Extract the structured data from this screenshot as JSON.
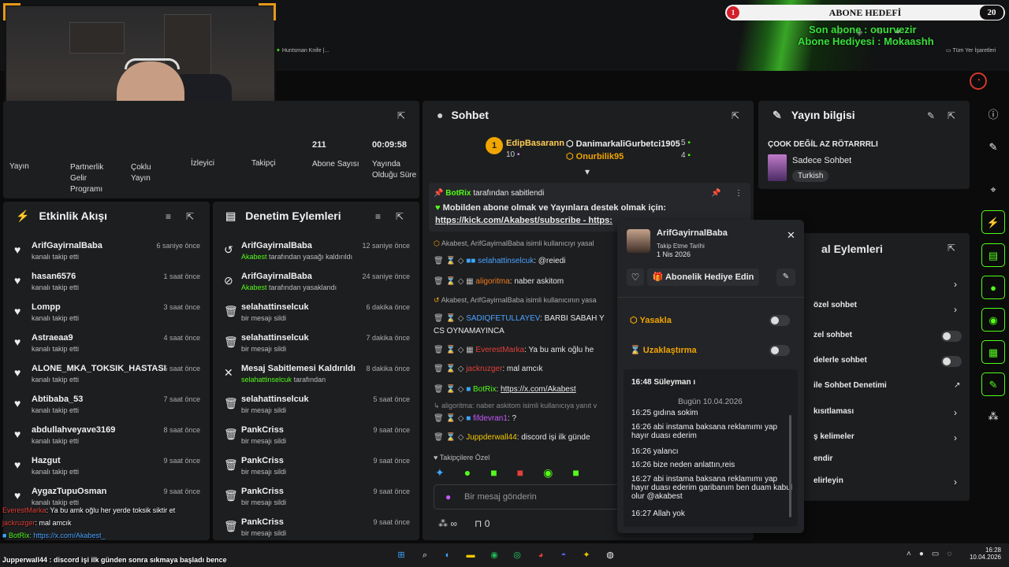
{
  "goal": {
    "left": "1",
    "title": "ABONE HEDEFİ",
    "right": "20"
  },
  "sub": {
    "last": "Son abone : onurvezir",
    "gift": "Abone Hediyesi : Mokaashh"
  },
  "browser": {
    "bookmark": "Huntsman Knife |...",
    "all_bookmarks": "Tüm Yer İşaretleri"
  },
  "stats": {
    "tabs": [
      "Yayın",
      "Partnerlik Gelir Programı",
      "Çoklu Yayın",
      "İzleyici",
      "Takipçi",
      "Abone Sayısı",
      "Yayında Olduğu Süre"
    ],
    "subs_value": "211",
    "time_value": "00:09:58"
  },
  "activity": {
    "title": "Etkinlik Akışı",
    "items": [
      {
        "name": "ArifGayirnalBaba",
        "sub": "kanalı takip etti",
        "time": "6 saniye önce"
      },
      {
        "name": "hasan6576",
        "sub": "kanalı takip etti",
        "time": "1 saat önce"
      },
      {
        "name": "Lompp",
        "sub": "kanalı takip etti",
        "time": "3 saat önce"
      },
      {
        "name": "Astraeaa9",
        "sub": "kanalı takip etti",
        "time": "4 saat önce"
      },
      {
        "name": "ALONE_MKA_TOKSIK_HASTASI",
        "sub": "kanalı takip etti",
        "time": "5 saat önce"
      },
      {
        "name": "Abtibaba_53",
        "sub": "kanalı takip etti",
        "time": "7 saat önce"
      },
      {
        "name": "abdullahveyave3169",
        "sub": "kanalı takip etti",
        "time": "8 saat önce"
      },
      {
        "name": "Hazgut",
        "sub": "kanalı takip etti",
        "time": "9 saat önce"
      },
      {
        "name": "AygazTupuOsman",
        "sub": "kanalı takip etti",
        "time": "9 saat önce"
      }
    ]
  },
  "moderation": {
    "title": "Denetim Eylemleri",
    "items": [
      {
        "name": "ArifGayirnalBaba",
        "sub_green": "Akabest",
        "sub": "tarafından yasağı kaldırıldı",
        "time": "12 saniye önce",
        "icon": "↺"
      },
      {
        "name": "ArifGayirnalBaba",
        "sub_green": "Akabest",
        "sub": "tarafından yasaklandı",
        "time": "24 saniye önce",
        "icon": "⊘"
      },
      {
        "name": "selahattinselcuk",
        "sub_green": "",
        "sub": "bir mesajı sildi",
        "time": "6 dakika önce",
        "icon": "🗑"
      },
      {
        "name": "selahattinselcuk",
        "sub_green": "",
        "sub": "bir mesajı sildi",
        "time": "7 dakika önce",
        "icon": "🗑"
      },
      {
        "name": "Mesaj Sabitlemesi Kaldırıldı",
        "sub_green": "selahattinselcuk",
        "sub": "tarafından",
        "time": "8 dakika önce",
        "icon": "✕"
      },
      {
        "name": "selahattinselcuk",
        "sub_green": "",
        "sub": "bir mesajı sildi",
        "time": "5 saat önce",
        "icon": "🗑"
      },
      {
        "name": "PankCriss",
        "sub_green": "",
        "sub": "bir mesajı sildi",
        "time": "9 saat önce",
        "icon": "🗑"
      },
      {
        "name": "PankCriss",
        "sub_green": "",
        "sub": "bir mesajı sildi",
        "time": "9 saat önce",
        "icon": "🗑"
      },
      {
        "name": "PankCriss",
        "sub_green": "",
        "sub": "bir mesajı sildi",
        "time": "9 saat önce",
        "icon": "🗑"
      },
      {
        "name": "PankCriss",
        "sub_green": "",
        "sub": "bir mesajı sildi",
        "time": "9 saat önce",
        "icon": "🗑"
      }
    ]
  },
  "chat": {
    "title": "Sohbet",
    "top1": "EdipBasarann",
    "top1_count": "10",
    "top2": "DanimarkaliGurbetci1905",
    "top2_count": "5",
    "top3": "Onurbilik95",
    "top3_count": "4",
    "pinned_by": "BotRix",
    "pinned_suffix": "tarafından sabitlendi",
    "pinned_text": "Mobilden abone olmak ve Yayınlara destek olmak için:",
    "pinned_link": "https://kick.com/Akabest/subscribe - https:",
    "reply1": "Akabest, ArifGayirnalBaba isimli kullanıcıyı yasal",
    "m1_user": "selahattinselcuk",
    "m1_text": "@reiedi",
    "m2_user": "aligoritma",
    "m2_text": "naber askitom",
    "reply2": "Akabest, ArifGayirnalBaba isimli kullanıcının yasa",
    "m3_user": "SADIQFETULLAYEV",
    "m3_text": "BARBI SABAH Y",
    "m3_cont": "CS OYNAMAYINCA",
    "m4_user": "EverestMarka",
    "m4_text": "Ya bu amk oğlu he",
    "m5_user": "jackruzger",
    "m5_text": "mal amcık",
    "m6_user": "BotRix",
    "m6_text": "https://x.com/Akabest",
    "reply3": "aligoritma: naber askitom isimli kullanıcıya yanıt v",
    "m7_user": "fifdevran1",
    "m7_text": "?",
    "m8_user": "Juppderwall44",
    "m8_text": "discord işi ilk günde",
    "emote_label": "Takipçilere Özel",
    "input_placeholder": "Bir mesaj gönderin",
    "viewer_count": "0"
  },
  "info": {
    "title": "Yayın bilgisi",
    "stream_title": "ÇOOK DEĞİL AZ RÖTARRRLI",
    "category": "Sadece Sohbet",
    "language": "Turkish"
  },
  "mod_actions": {
    "title": "al Eylemleri",
    "items": [
      "özel sohbet",
      "zel sohbet",
      "delerle sohbet",
      "ile Sohbet Denetimi",
      "kısıtlaması",
      "ş kelimeler",
      "endir",
      "elirleyin"
    ]
  },
  "popup": {
    "user": "ArifGayirnalBaba",
    "follow_label": "Takip Etme Tarihi",
    "follow_date": "1 Nis 2026",
    "gift_btn": "Abonelik Hediye Edin",
    "ban": "Yasakla",
    "timeout": "Uzaklaştırma",
    "log": [
      {
        "t": "16:48 Süleyman ı"
      },
      {
        "t": "16:25 gıdına sokim"
      },
      {
        "t": "16:26 abi instama baksana reklamımı yap hayır duası ederim"
      },
      {
        "t": "16:26 yalancı"
      },
      {
        "t": "16:26 bize neden anlattın,reis"
      },
      {
        "t": "16:27 abi instama baksana reklamımı yap hayır duası ederim garibanım ben duam kabul olur @akabest"
      },
      {
        "t": "16:27 Allah yok"
      }
    ],
    "day_sep": "Bugün 10.04.2026"
  },
  "overlay": {
    "l1_user": "EverestMarka",
    "l1_text": ": Ya bu amk oğlu her yerde toksik siktir et",
    "l2_user": "jackruzger",
    "l2_text": ": mal amcık",
    "l3_user": "BotRix",
    "l3_text": ": https://x.com/Akabest_",
    "l4_user": "fifdevran1",
    "l4_text": ": ?",
    "l5": "Jupperwall44 : discord işi ilk günden sonra sıkmaya başladı bence",
    "bg_name": "ALONE_MKA"
  },
  "clock": {
    "time": "16:28",
    "date": "10.04.2026"
  },
  "colors": {
    "kick_green": "#53fc18",
    "panel": "#1d1e20"
  }
}
